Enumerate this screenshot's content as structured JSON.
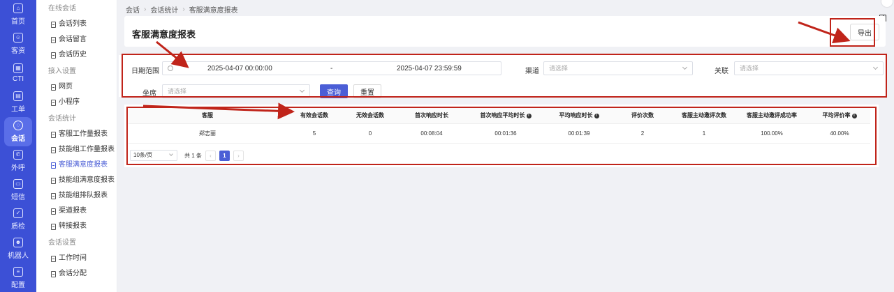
{
  "rail": [
    {
      "label": "首页",
      "icon": "home-icon",
      "glyph": "⌂"
    },
    {
      "label": "客资",
      "icon": "users-icon",
      "glyph": "☺"
    },
    {
      "label": "CTI",
      "icon": "grid-icon",
      "glyph": "▦"
    },
    {
      "label": "工单",
      "icon": "ticket-icon",
      "glyph": "▤"
    },
    {
      "label": "会话",
      "icon": "chat-icon",
      "glyph": "◌"
    },
    {
      "label": "外呼",
      "icon": "phone-icon",
      "glyph": "✆"
    },
    {
      "label": "短信",
      "icon": "sms-icon",
      "glyph": "▭"
    },
    {
      "label": "质检",
      "icon": "inspect-icon",
      "glyph": "✓"
    },
    {
      "label": "机器人",
      "icon": "robot-icon",
      "glyph": "☻"
    },
    {
      "label": "配置",
      "icon": "config-icon",
      "glyph": "≡"
    }
  ],
  "submenu": {
    "group_online": "在线会话",
    "online_items": [
      "会话列表",
      "会话留言",
      "会话历史"
    ],
    "group_access": "接入设置",
    "access_items": [
      "网页",
      "小程序"
    ],
    "group_stats": "会话统计",
    "stats_items": [
      "客服工作量报表",
      "技能组工作量报表",
      "客服满意度报表",
      "技能组满意度报表",
      "技能组排队报表",
      "渠道报表",
      "转接报表"
    ],
    "group_settings": "会话设置",
    "settings_items": [
      "工作时间",
      "会话分配"
    ]
  },
  "breadcrumb": [
    "会话",
    "会话统计",
    "客服满意度报表"
  ],
  "page_title": "客服满意度报表",
  "export_label": "导出",
  "filters": {
    "date_label": "日期范围",
    "date_start": "2025-04-07 00:00:00",
    "date_sep": "-",
    "date_end": "2025-04-07 23:59:59",
    "channel_label": "渠道",
    "channel_placeholder": "请选择",
    "relation_label": "关联",
    "relation_placeholder": "请选择",
    "seat_label": "坐席",
    "seat_placeholder": "请选择",
    "query_label": "查询",
    "reset_label": "重置"
  },
  "table": {
    "headers": [
      "客服",
      "有效会话数",
      "无效会话数",
      "首次响应时长",
      "首次响应平均时长",
      "平均响应时长",
      "评价次数",
      "客服主动邀评次数",
      "客服主动邀评成功率",
      "平均评价率"
    ],
    "info_marker": "i",
    "rows": [
      [
        "郑志丽",
        "5",
        "0",
        "00:08:04",
        "00:01:36",
        "00:01:39",
        "2",
        "1",
        "100.00%",
        "40.00%"
      ]
    ]
  },
  "pagination": {
    "page_size": "10条/页",
    "total": "共 1 条",
    "prev": "‹",
    "current": "1",
    "next": "›"
  },
  "colors": {
    "accent": "#4b5ed6",
    "annotation": "#c0241a"
  }
}
